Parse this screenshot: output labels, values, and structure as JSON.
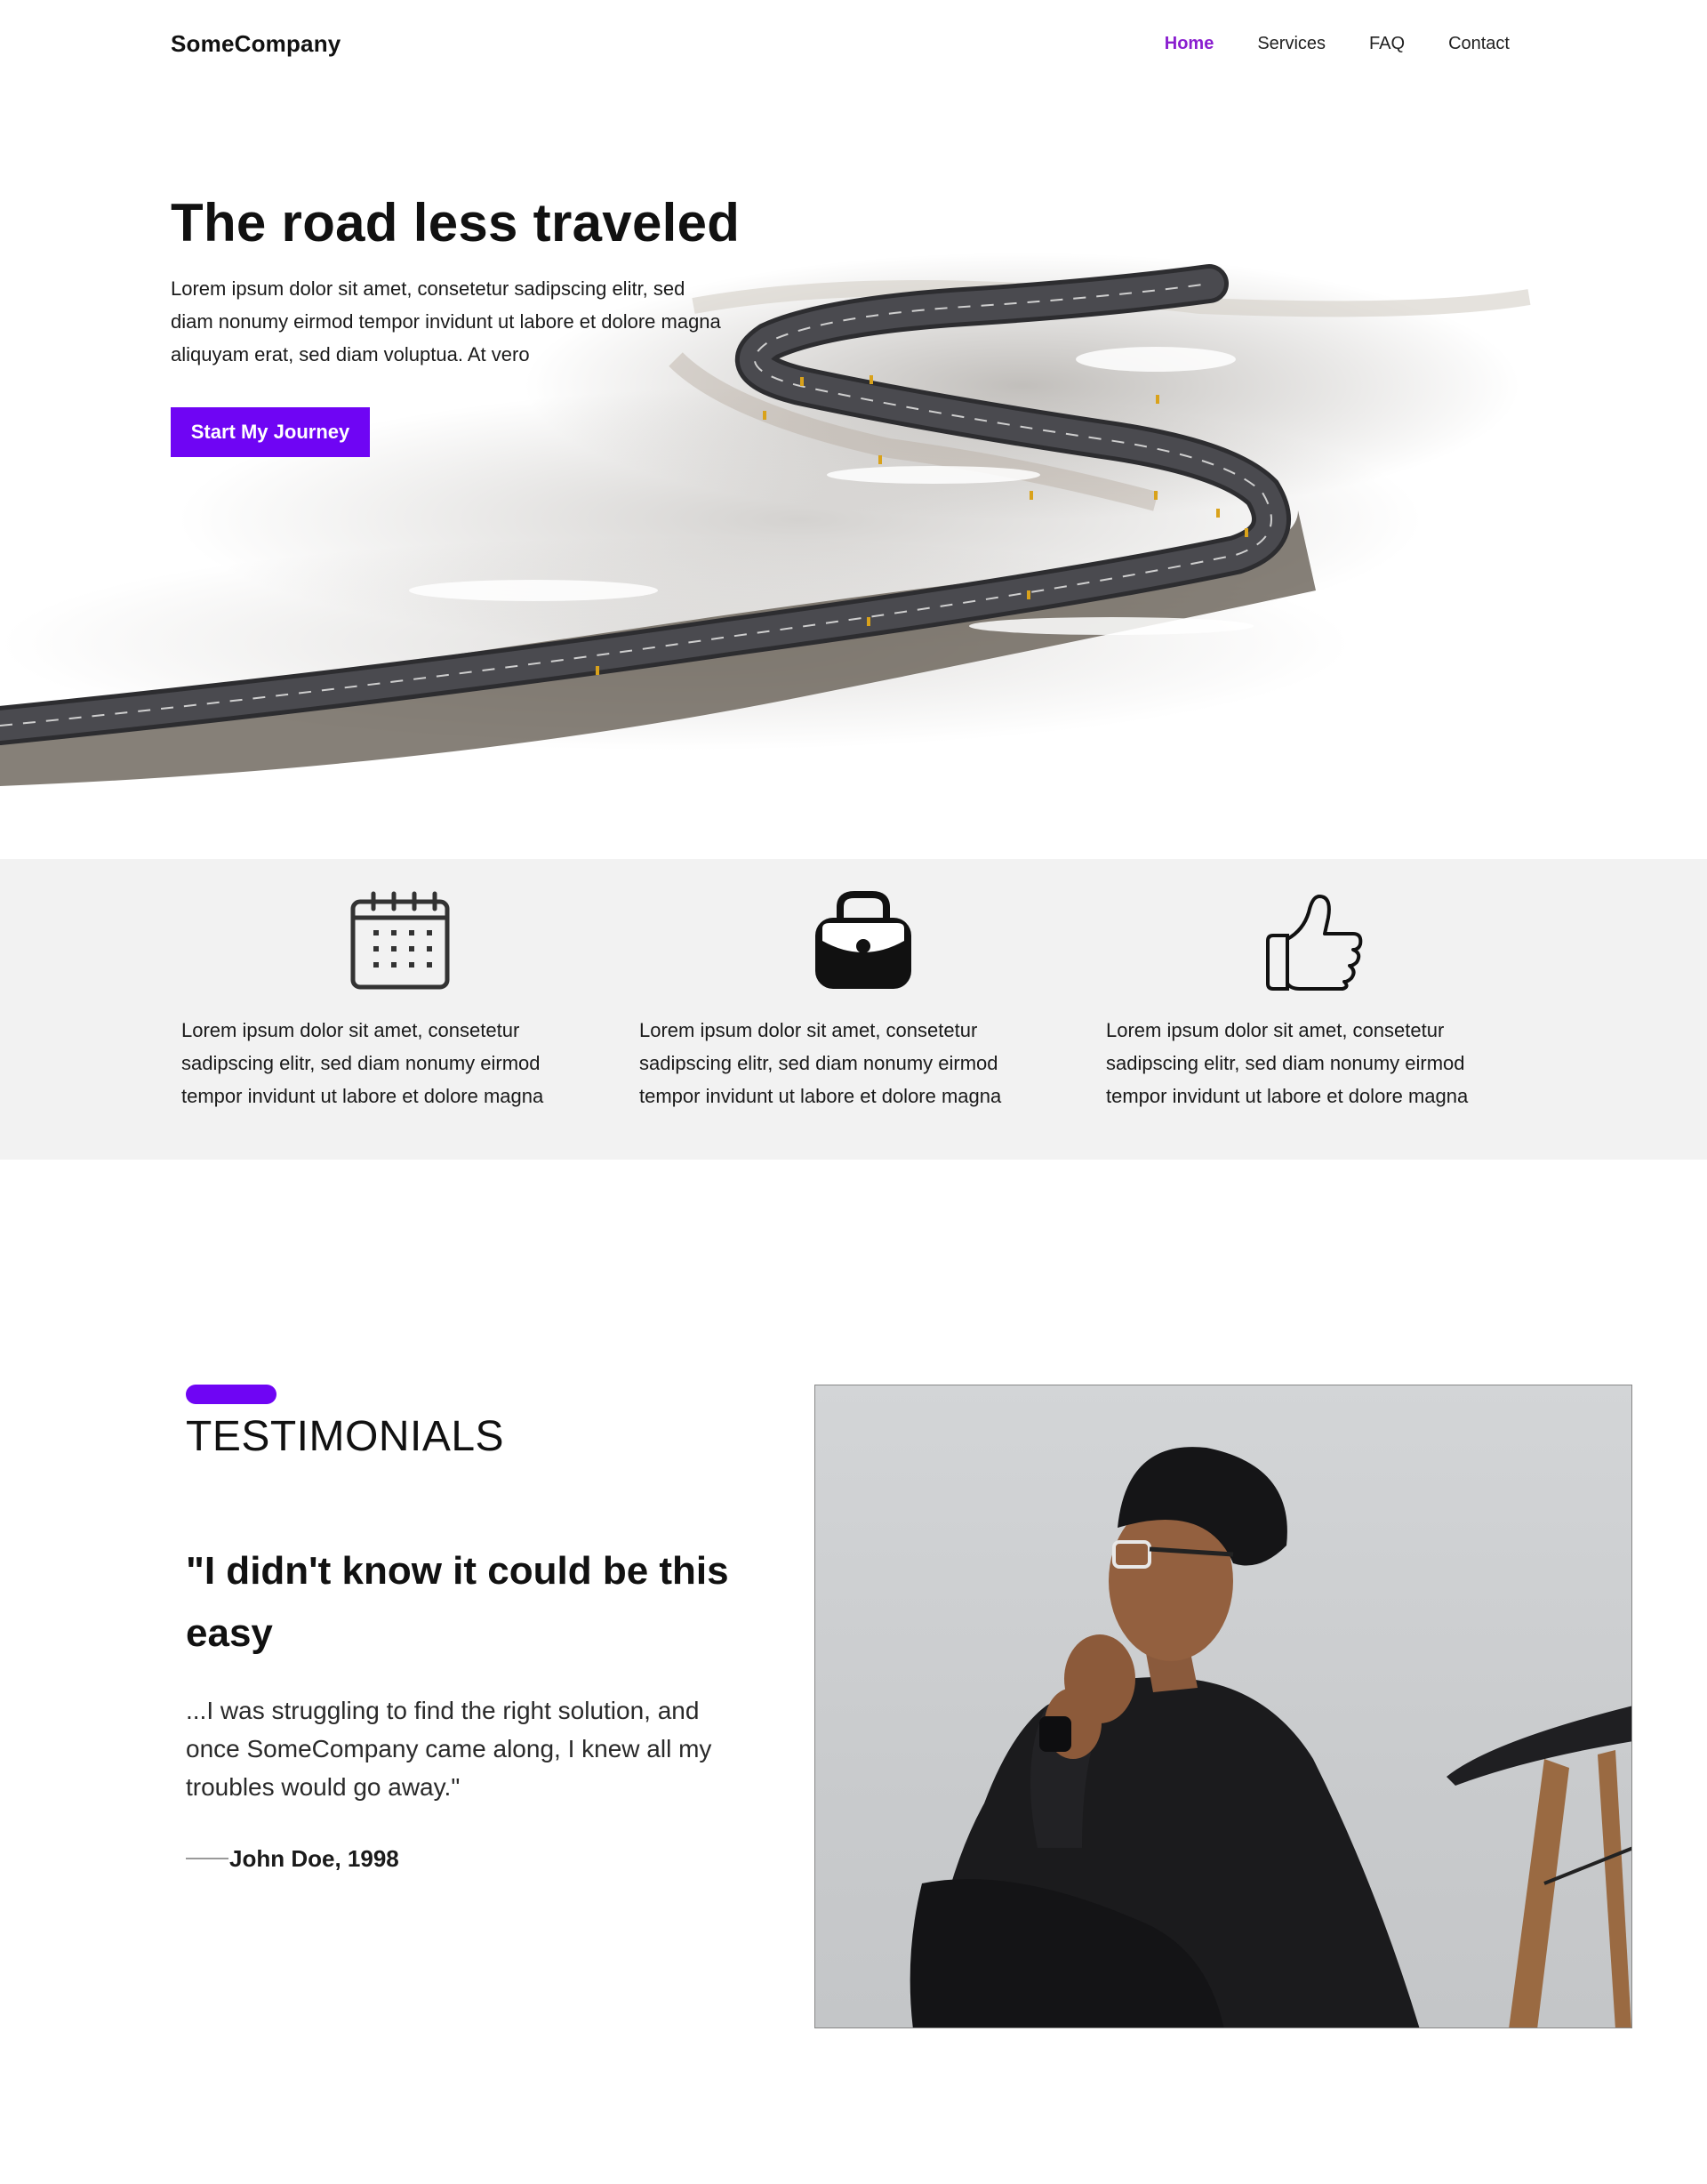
{
  "nav": {
    "brand": "SomeCompany",
    "items": [
      {
        "label": "Home",
        "active": true
      },
      {
        "label": "Services",
        "active": false
      },
      {
        "label": "FAQ",
        "active": false
      },
      {
        "label": "Contact",
        "active": false
      }
    ]
  },
  "hero": {
    "title": "The road less traveled",
    "text": "Lorem ipsum dolor sit amet, consetetur sadipscing elitr, sed diam nonumy eirmod tempor invidunt ut labore et dolore magna aliquyam erat, sed diam voluptua. At vero",
    "button_label": "Start My Journey"
  },
  "features": [
    {
      "icon": "calendar-icon",
      "text": "Lorem ipsum dolor sit amet, consetetur sadipscing elitr, sed diam nonumy eirmod tempor invidunt ut labore et dolore magna"
    },
    {
      "icon": "lock-bag-icon",
      "text": "Lorem ipsum dolor sit amet, consetetur sadipscing elitr, sed diam nonumy eirmod tempor invidunt ut labore et dolore magna"
    },
    {
      "icon": "thumbs-up-icon",
      "text": "Lorem ipsum dolor sit amet, consetetur sadipscing elitr, sed diam nonumy eirmod tempor invidunt ut labore et dolore magna"
    }
  ],
  "testimonials": {
    "heading": "TESTIMONIALS",
    "quote": "\"I didn't know it could be this easy",
    "body": "...I was struggling to find the right solution, and once SomeCompany came along, I knew all my troubles would go away.\"",
    "author": "John Doe, 1998"
  },
  "colors": {
    "accent": "#6f05f4",
    "nav_active": "#8a1fcf",
    "features_bg": "#f2f2f2"
  }
}
